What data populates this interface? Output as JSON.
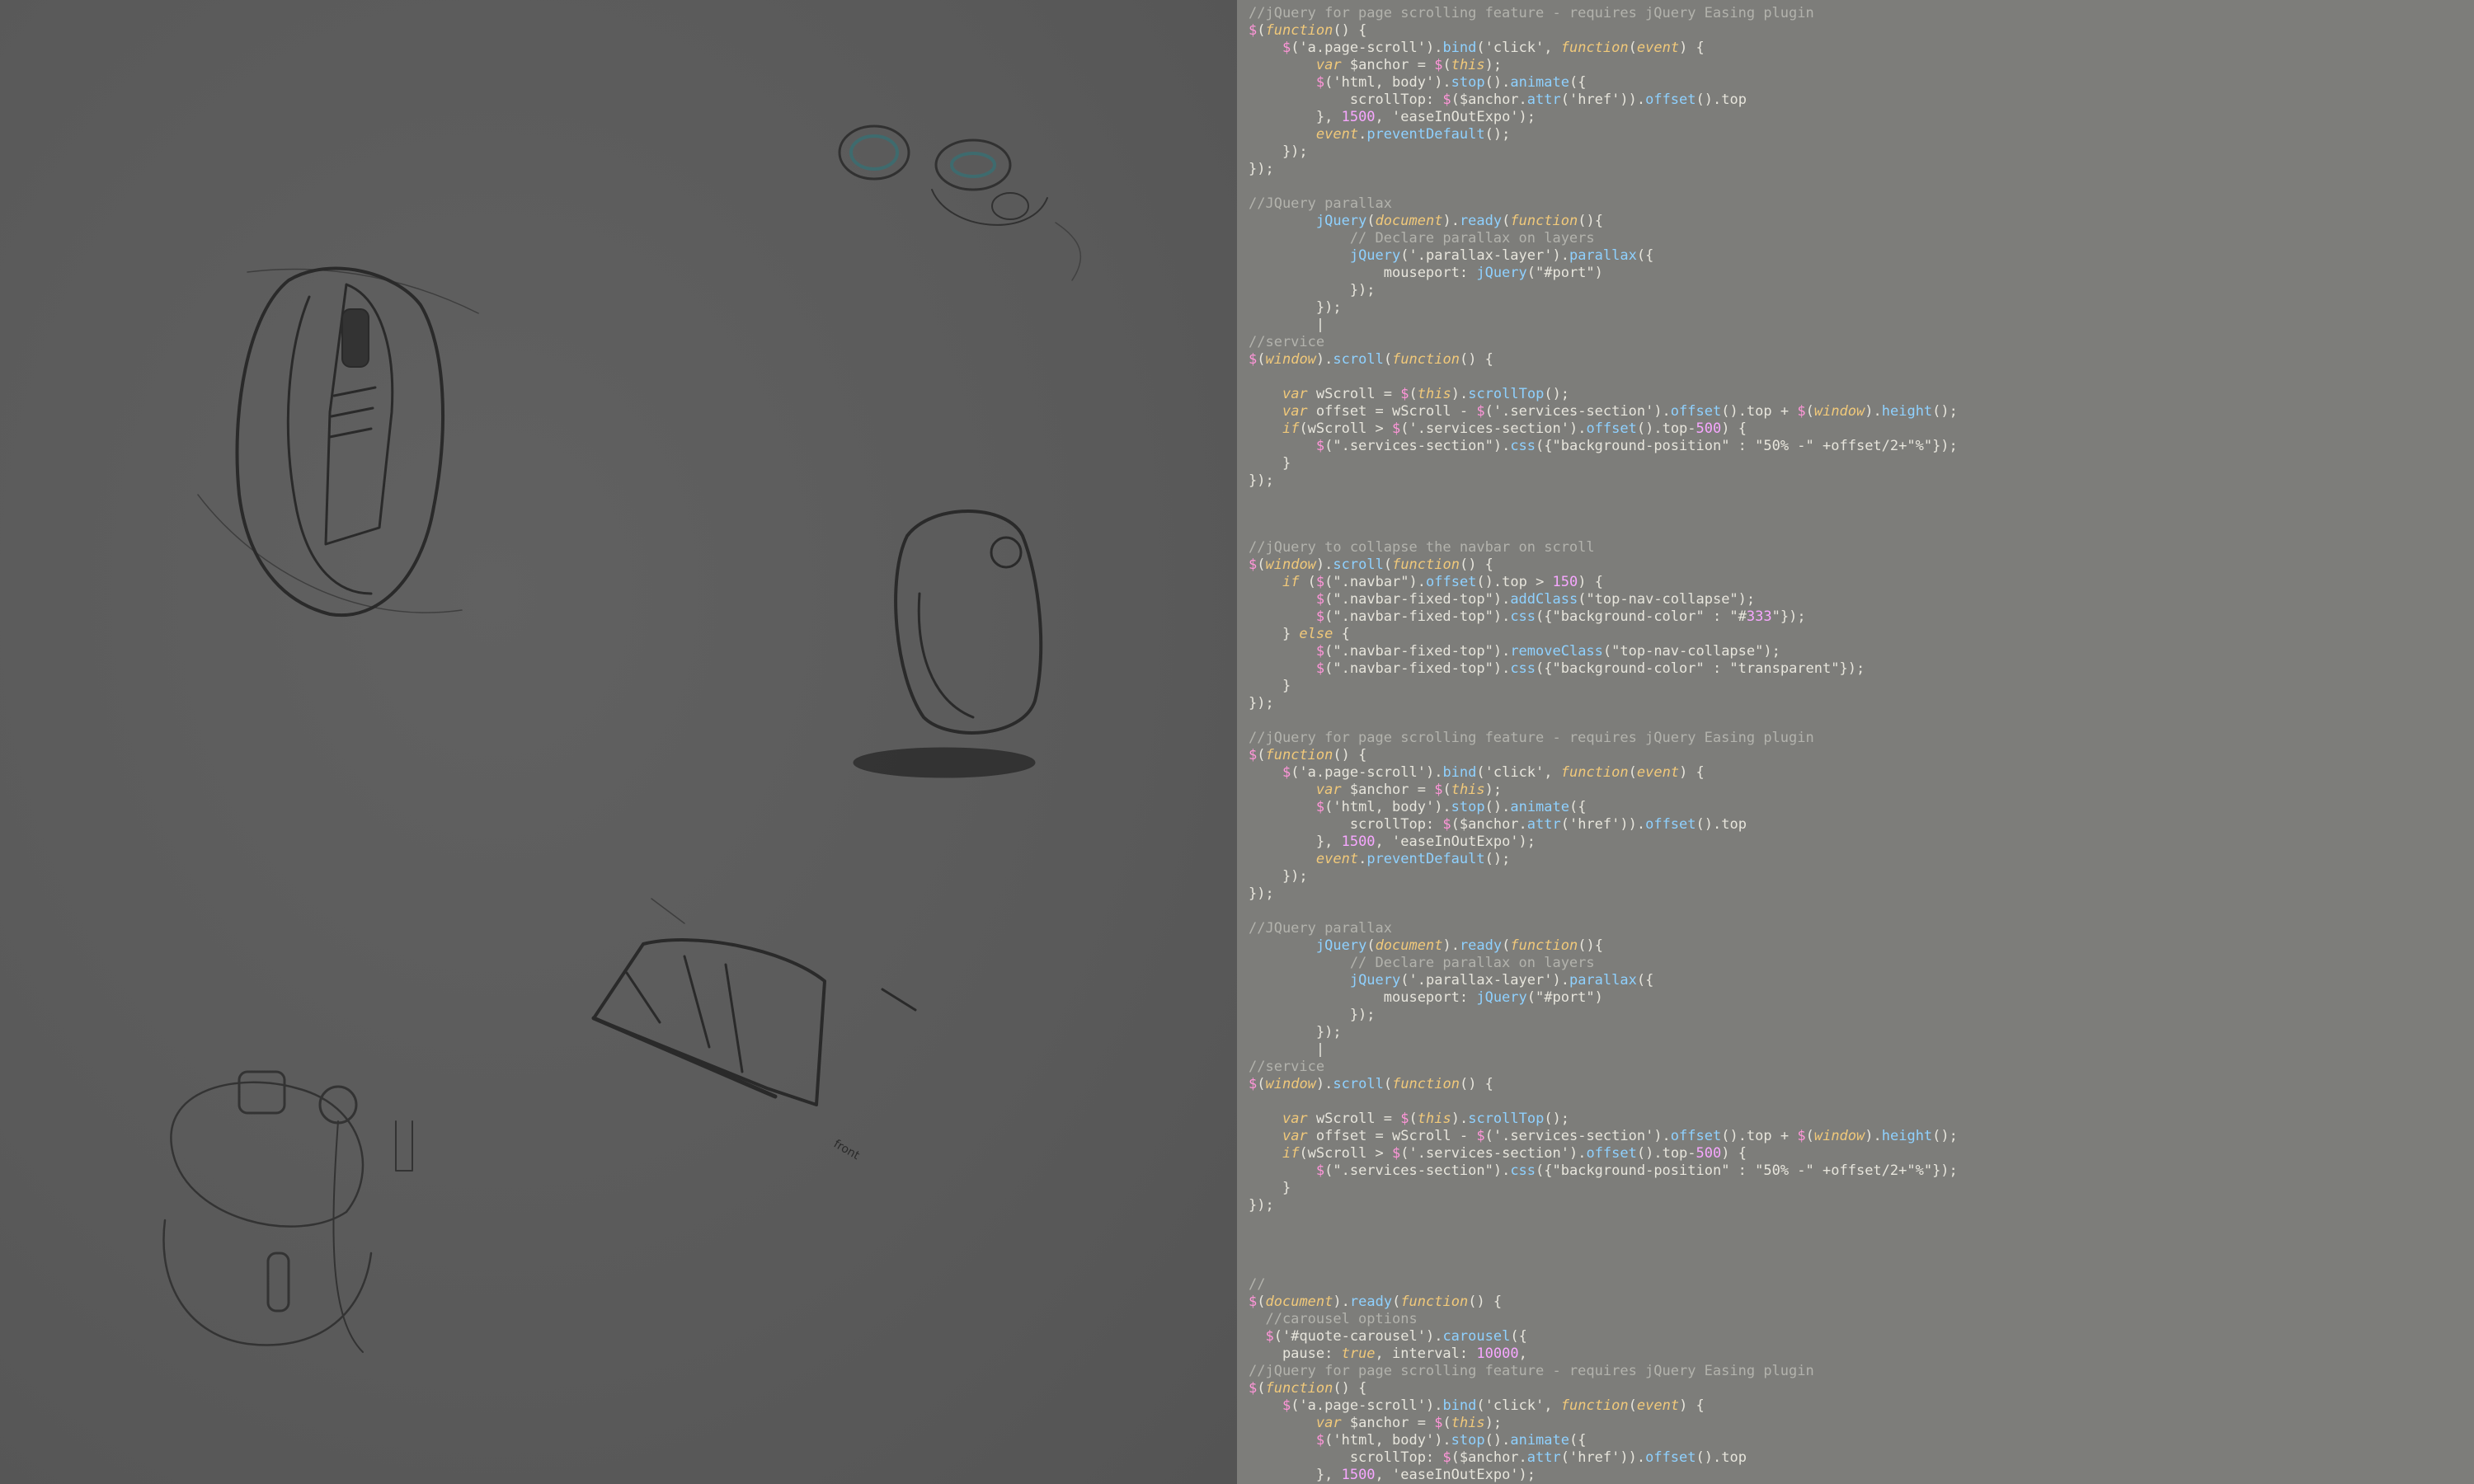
{
  "sketch": {
    "icons": [
      "mouse-perspective-sketch",
      "mouse-side-sketch",
      "mouse-top-sketch",
      "scroll-wheel-sketch",
      "joystick-controls-sketch"
    ],
    "label": "front"
  },
  "code_blocks": [
    {
      "lines": [
        "//jQuery for page scrolling feature - requires jQuery Easing plugin",
        "$(function() {",
        "    $('a.page-scroll').bind('click', function(event) {",
        "        var $anchor = $(this);",
        "        $('html, body').stop().animate({",
        "            scrollTop: $($anchor.attr('href')).offset().top",
        "        }, 1500, 'easeInOutExpo');",
        "        event.preventDefault();",
        "    });",
        "});",
        "",
        "//JQuery parallax",
        "        jQuery(document).ready(function(){",
        "            // Declare parallax on layers",
        "            jQuery('.parallax-layer').parallax({",
        "                mouseport: jQuery(\"#port\")",
        "            });",
        "        });",
        "        |",
        "//service",
        "$(window).scroll(function() {",
        "",
        "    var wScroll = $(this).scrollTop();",
        "    var offset = wScroll - $('.services-section').offset().top + $(window).height();",
        "    if(wScroll > $('.services-section').offset().top-500) {",
        "        $(\".services-section\").css({\"background-position\" : \"50% -\" +offset/2+\"%\"});",
        "    }",
        "});"
      ]
    },
    {
      "lines": [
        "//jQuery to collapse the navbar on scroll",
        "$(window).scroll(function() {",
        "    if ($(\".navbar\").offset().top > 150) {",
        "        $(\".navbar-fixed-top\").addClass(\"top-nav-collapse\");",
        "        $(\".navbar-fixed-top\").css({\"background-color\" : \"#333\"});",
        "    } else {",
        "        $(\".navbar-fixed-top\").removeClass(\"top-nav-collapse\");",
        "        $(\".navbar-fixed-top\").css({\"background-color\" : \"transparent\"});",
        "    }",
        "});",
        "",
        "//jQuery for page scrolling feature - requires jQuery Easing plugin",
        "$(function() {",
        "    $('a.page-scroll').bind('click', function(event) {",
        "        var $anchor = $(this);",
        "        $('html, body').stop().animate({",
        "            scrollTop: $($anchor.attr('href')).offset().top",
        "        }, 1500, 'easeInOutExpo');",
        "        event.preventDefault();",
        "    });",
        "});",
        "",
        "//JQuery parallax",
        "        jQuery(document).ready(function(){",
        "            // Declare parallax on layers",
        "            jQuery('.parallax-layer').parallax({",
        "                mouseport: jQuery(\"#port\")",
        "            });",
        "        });",
        "        |",
        "//service",
        "$(window).scroll(function() {",
        "",
        "    var wScroll = $(this).scrollTop();",
        "    var offset = wScroll - $('.services-section').offset().top + $(window).height();",
        "    if(wScroll > $('.services-section').offset().top-500) {",
        "        $(\".services-section\").css({\"background-position\" : \"50% -\" +offset/2+\"%\"});",
        "    }",
        "});"
      ]
    },
    {
      "lines": [
        "//",
        "$(document).ready(function() {",
        "  //carousel options",
        "  $('#quote-carousel').carousel({",
        "    pause: true, interval: 10000,",
        "//jQuery for page scrolling feature - requires jQuery Easing plugin",
        "$(function() {",
        "    $('a.page-scroll').bind('click', function(event) {",
        "        var $anchor = $(this);",
        "        $('html, body').stop().animate({",
        "            scrollTop: $($anchor.attr('href')).offset().top",
        "        }, 1500, 'easeInOutExpo');"
      ]
    }
  ],
  "colors": {
    "code_bg": "#7d7d7a",
    "sketch_bg": "#5a5a5a",
    "comment": "#b3b3ad",
    "function": "#8fd1ff",
    "keyword": "#f1c97a",
    "dollar": "#ff96d9",
    "number": "#f7a7ff"
  }
}
